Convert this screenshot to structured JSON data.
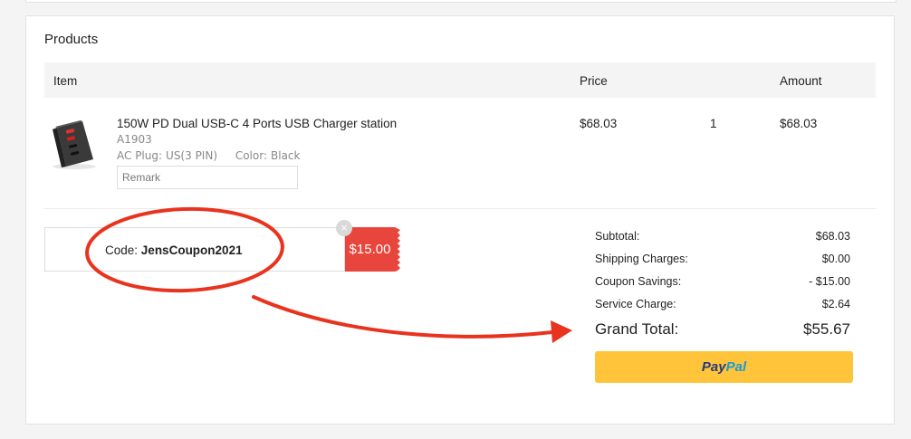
{
  "products": {
    "title": "Products",
    "columns": {
      "item": "Item",
      "price": "Price",
      "amount": "Amount"
    },
    "items": [
      {
        "name": "150W PD Dual USB-C 4 Ports USB Charger station",
        "sku": "A1903",
        "plug_label": "AC Plug:",
        "plug_value": "US(3 PIN)",
        "color_label": "Color:",
        "color_value": "Black",
        "remark_placeholder": "Remark",
        "price": "$68.03",
        "quantity": "1",
        "amount": "$68.03"
      }
    ]
  },
  "coupon": {
    "code_label": "Code:",
    "code": "JensCoupon2021",
    "value": "$15.00"
  },
  "summary": {
    "subtotal_label": "Subtotal:",
    "subtotal": "$68.03",
    "shipping_label": "Shipping Charges:",
    "shipping": "$0.00",
    "coupon_label": "Coupon Savings:",
    "coupon": "- $15.00",
    "service_label": "Service Charge:",
    "service": "$2.64",
    "grand_total_label": "Grand Total:",
    "grand_total": "$55.67"
  },
  "paypal": {
    "label_part1": "Pay",
    "label_part2": "Pal",
    "color": "#ffc439"
  },
  "colors": {
    "coupon_badge": "#e8453c",
    "annotation": "#e8331e"
  }
}
